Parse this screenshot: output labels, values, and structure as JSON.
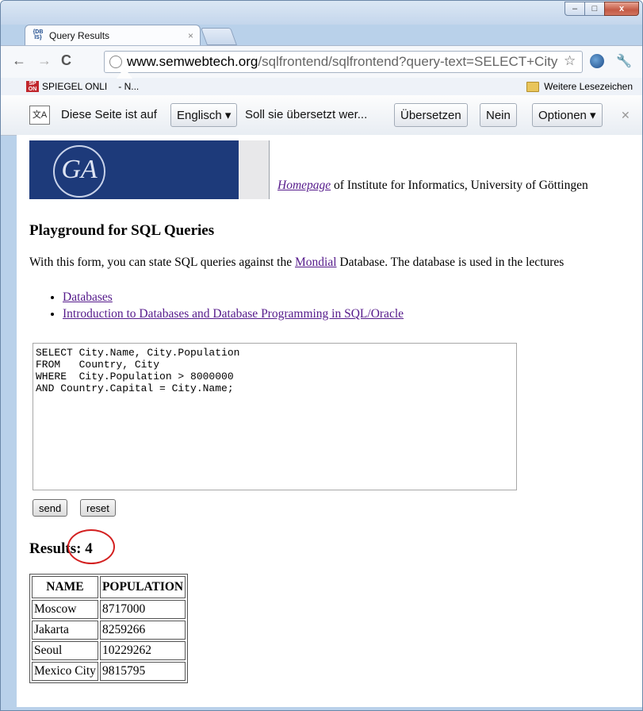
{
  "tab": {
    "title": "Query Results",
    "close": "×",
    "favicon": "{DB\nIS}"
  },
  "window_controls": {
    "minimize": "–",
    "maximize": "□",
    "close": "x"
  },
  "toolbar": {
    "back": "←",
    "forward": "→",
    "reload": "C",
    "url_host": "www.semwebtech.org",
    "url_path": "/sqlfrontend/sqlfrontend?query-text=SELECT+City",
    "star": "☆",
    "wrench": "🔧"
  },
  "bookmarks": {
    "left_label": "SPIEGEL ONLI",
    "left_tail": "- N...",
    "left_icon": "SP\nON",
    "right_label": "Weitere Lesezeichen"
  },
  "translate_bar": {
    "icon": "文A",
    "prefix": "Diese Seite ist auf",
    "language": "Englisch ▾",
    "question": "Soll sie übersetzt wer...",
    "translate_btn": "Übersetzen",
    "no_btn": "Nein",
    "options_btn": "Optionen ▾",
    "close": "✕"
  },
  "page": {
    "logo_seal": "GA",
    "homepage_link": "Homepage",
    "header_text": " of Institute for Informatics, University of Göttingen",
    "title": "Playground for SQL Queries",
    "intro_before": "With this form, you can state SQL queries against the ",
    "intro_link": "Mondial",
    "intro_after": " Database. The database is used in the lectures",
    "links": [
      "Databases",
      "Introduction to Databases and Database Programming in SQL/Oracle"
    ],
    "query": "SELECT City.Name, City.Population\nFROM   Country, City\nWHERE  City.Population > 8000000\nAND Country.Capital = City.Name;",
    "send_label": "send",
    "reset_label": "reset",
    "results_heading": "Results: 4",
    "table": {
      "headers": [
        "NAME",
        "POPULATION"
      ],
      "rows": [
        [
          "Moscow",
          "8717000"
        ],
        [
          "Jakarta",
          "8259266"
        ],
        [
          "Seoul",
          "10229262"
        ],
        [
          "Mexico City",
          "9815795"
        ]
      ]
    }
  },
  "colors": {
    "link": "#551a8b",
    "logo_bg": "#1d3a7a",
    "annotation_circle": "#d32020"
  }
}
